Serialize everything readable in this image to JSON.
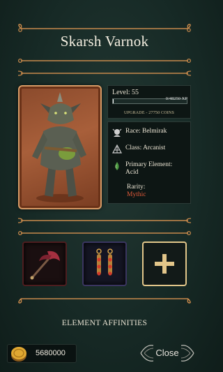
{
  "character": {
    "name": "Skarsh Varnok",
    "level_label": "Level: 55",
    "xp_text": "0/48250 XP",
    "xp_progress": 0.01,
    "upgrade_text": "UPGRADE - 27750 COINS"
  },
  "info": {
    "race": "Race: Belmirak",
    "class": "Class: Arcanist",
    "element_label": "Primary Element:",
    "element_value": "Acid",
    "rarity_label": "Rarity:",
    "rarity_value": "Mythic",
    "rarity_color": "#e25a3a"
  },
  "equipment": {
    "slots": [
      {
        "item": "axe-icon"
      },
      {
        "item": "earrings-icon"
      },
      {
        "item": "plus-icon",
        "label": "+"
      }
    ]
  },
  "affinities_title": "ELEMENT AFFINITIES",
  "coins": {
    "icon": "coin-icon",
    "amount": "5680000"
  },
  "close_button": {
    "label": "Close"
  },
  "colors": {
    "background": "#172a26",
    "ornament": "#c88a4c",
    "accent_gold": "#e2c68a"
  }
}
